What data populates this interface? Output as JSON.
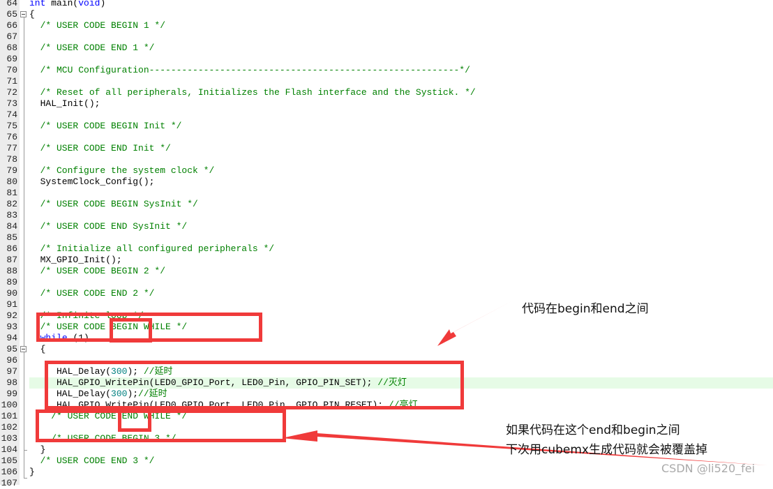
{
  "editor": {
    "lines": [
      {
        "n": "64",
        "tokens": [
          {
            "t": "int",
            "c": "kw"
          },
          {
            "t": " main(",
            "c": ""
          },
          {
            "t": "void",
            "c": "kw"
          },
          {
            "t": ")",
            "c": ""
          }
        ]
      },
      {
        "n": "65",
        "tokens": [
          {
            "t": "{",
            "c": ""
          }
        ]
      },
      {
        "n": "66",
        "tokens": [
          {
            "t": "  /* USER CODE BEGIN 1 */",
            "c": "cm"
          }
        ]
      },
      {
        "n": "67",
        "tokens": []
      },
      {
        "n": "68",
        "tokens": [
          {
            "t": "  /* USER CODE END 1 */",
            "c": "cm"
          }
        ]
      },
      {
        "n": "69",
        "tokens": []
      },
      {
        "n": "70",
        "tokens": [
          {
            "t": "  /* MCU Configuration---------------------------------------------------------*/",
            "c": "cm"
          }
        ]
      },
      {
        "n": "71",
        "tokens": []
      },
      {
        "n": "72",
        "tokens": [
          {
            "t": "  /* Reset of all peripherals, Initializes the Flash interface and the Systick. */",
            "c": "cm"
          }
        ]
      },
      {
        "n": "73",
        "tokens": [
          {
            "t": "  HAL_Init();",
            "c": ""
          }
        ]
      },
      {
        "n": "74",
        "tokens": []
      },
      {
        "n": "75",
        "tokens": [
          {
            "t": "  /* USER CODE BEGIN Init */",
            "c": "cm"
          }
        ]
      },
      {
        "n": "76",
        "tokens": []
      },
      {
        "n": "77",
        "tokens": [
          {
            "t": "  /* USER CODE END Init */",
            "c": "cm"
          }
        ]
      },
      {
        "n": "78",
        "tokens": []
      },
      {
        "n": "79",
        "tokens": [
          {
            "t": "  /* Configure the system clock */",
            "c": "cm"
          }
        ]
      },
      {
        "n": "80",
        "tokens": [
          {
            "t": "  SystemClock_Config();",
            "c": ""
          }
        ]
      },
      {
        "n": "81",
        "tokens": []
      },
      {
        "n": "82",
        "tokens": [
          {
            "t": "  /* USER CODE BEGIN SysInit */",
            "c": "cm"
          }
        ]
      },
      {
        "n": "83",
        "tokens": []
      },
      {
        "n": "84",
        "tokens": [
          {
            "t": "  /* USER CODE END SysInit */",
            "c": "cm"
          }
        ]
      },
      {
        "n": "85",
        "tokens": []
      },
      {
        "n": "86",
        "tokens": [
          {
            "t": "  /* Initialize all configured peripherals */",
            "c": "cm"
          }
        ]
      },
      {
        "n": "87",
        "tokens": [
          {
            "t": "  MX_GPIO_Init();",
            "c": ""
          }
        ]
      },
      {
        "n": "88",
        "tokens": [
          {
            "t": "  /* USER CODE BEGIN 2 */",
            "c": "cm"
          }
        ]
      },
      {
        "n": "89",
        "tokens": []
      },
      {
        "n": "90",
        "tokens": [
          {
            "t": "  /* USER CODE END 2 */",
            "c": "cm"
          }
        ]
      },
      {
        "n": "91",
        "tokens": []
      },
      {
        "n": "92",
        "tokens": [
          {
            "t": "  /* Infinite loop */",
            "c": "cm"
          }
        ]
      },
      {
        "n": "93",
        "tokens": [
          {
            "t": "  /* USER CODE BEGIN WHILE */",
            "c": "cm"
          }
        ]
      },
      {
        "n": "94",
        "tokens": [
          {
            "t": "  ",
            "c": ""
          },
          {
            "t": "while",
            "c": "kw"
          },
          {
            "t": " (1)",
            "c": ""
          }
        ]
      },
      {
        "n": "95",
        "tokens": [
          {
            "t": "  {",
            "c": ""
          }
        ]
      },
      {
        "n": "96",
        "tokens": []
      },
      {
        "n": "97",
        "tokens": [
          {
            "t": "     HAL_Delay(",
            "c": ""
          },
          {
            "t": "300",
            "c": "num"
          },
          {
            "t": "); ",
            "c": ""
          },
          {
            "t": "//延时",
            "c": "cm"
          }
        ]
      },
      {
        "n": "98",
        "highlight": true,
        "tokens": [
          {
            "t": "     HAL_GPIO_WritePin(LED0_GPIO_Port, LED0_Pin, GPIO_PIN_SET); ",
            "c": ""
          },
          {
            "t": "//灭灯",
            "c": "cm"
          }
        ]
      },
      {
        "n": "99",
        "tokens": [
          {
            "t": "     HAL_Delay(",
            "c": ""
          },
          {
            "t": "300",
            "c": "num"
          },
          {
            "t": ");",
            "c": ""
          },
          {
            "t": "//延时",
            "c": "cm"
          }
        ]
      },
      {
        "n": "100",
        "tokens": [
          {
            "t": "     HAL_GPIO_WritePin(LED0_GPIO_Port, LED0_Pin, GPIO_PIN_RESET); ",
            "c": ""
          },
          {
            "t": "//亮灯",
            "c": "cm"
          }
        ]
      },
      {
        "n": "101",
        "tokens": [
          {
            "t": "    /* USER CODE END WHILE */",
            "c": "cm"
          }
        ]
      },
      {
        "n": "102",
        "tokens": []
      },
      {
        "n": "103",
        "tokens": [
          {
            "t": "    /* USER CODE BEGIN 3 */",
            "c": "cm"
          }
        ]
      },
      {
        "n": "104",
        "tokens": [
          {
            "t": "  }",
            "c": ""
          }
        ]
      },
      {
        "n": "105",
        "tokens": [
          {
            "t": "  /* USER CODE END 3 */",
            "c": "cm"
          }
        ]
      },
      {
        "n": "106",
        "tokens": [
          {
            "t": "}",
            "c": ""
          }
        ]
      },
      {
        "n": "107",
        "tokens": []
      }
    ]
  },
  "annotations": {
    "note1": "代码在begin和end之间",
    "note2_line1": "如果代码在这个end和begin之间",
    "note2_line2": "下次用cubemx生成代码就会被覆盖掉",
    "color": "#f03a3a"
  },
  "watermark": "CSDN @li520_fei",
  "colors": {
    "keyword": "#0000ff",
    "comment": "#008000",
    "number": "#008080",
    "highlight": "#e6fbe6"
  }
}
